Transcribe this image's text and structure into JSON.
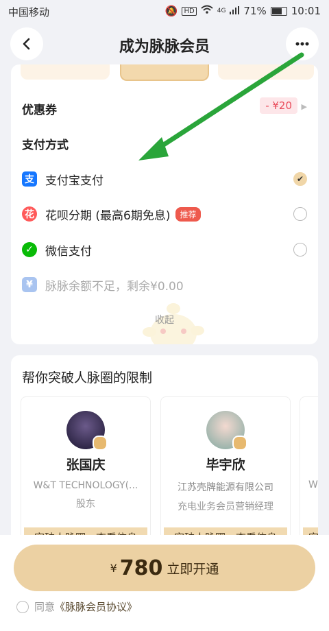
{
  "status_bar": {
    "carrier": "中国移动",
    "hd": "HD",
    "net": "4G",
    "battery": "71%",
    "time": "10:01"
  },
  "header": {
    "title": "成为脉脉会员"
  },
  "coupon": {
    "label": "优惠券",
    "value": "- ¥20"
  },
  "payment": {
    "heading": "支付方式",
    "methods": [
      {
        "label": "支付宝支付",
        "icon": "alipay-icon",
        "selected": true,
        "color": "#1677ff"
      },
      {
        "label": "花呗分期 (最高6期免息)",
        "tag": "推荐",
        "icon": "huabei-icon",
        "selected": false,
        "color": "#ff5a5a"
      },
      {
        "label": "微信支付",
        "icon": "wechat-icon",
        "selected": false,
        "color": "#09bb07"
      },
      {
        "label": "脉脉余额不足，剩余¥0.00",
        "icon": "balance-icon",
        "disabled": true,
        "color": "#a9c4f0"
      }
    ],
    "collapse": "收起"
  },
  "network": {
    "title": "帮你突破人脉圈的限制",
    "people": [
      {
        "name": "张国庆",
        "company": "W&T TECHNOLOGY(...",
        "position": "股东",
        "button": "突破人脉圈，查看信息"
      },
      {
        "name": "毕宇欣",
        "company": "江苏壳牌能源有限公司",
        "position": "充电业务会员营销经理",
        "button": "突破人脉圈，查看信息"
      },
      {
        "company": "W",
        "button": "突"
      }
    ]
  },
  "cta": {
    "currency": "¥",
    "price": "780",
    "label": "立即开通"
  },
  "agreement": {
    "prefix": "同意",
    "link": "《脉脉会员协议》"
  },
  "colors": {
    "accent": "#ecd1a3",
    "annotation_arrow": "#2aa53a"
  }
}
